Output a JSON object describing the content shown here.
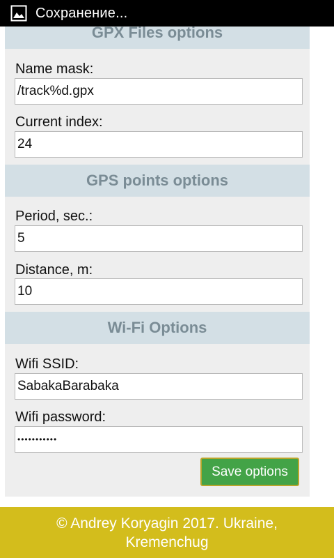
{
  "status_bar": {
    "text": "Сохранение...",
    "icon": "image-icon"
  },
  "gpx_section": {
    "title": "GPX Files options",
    "name_mask_label": "Name mask:",
    "name_mask_value": "/track%d.gpx",
    "current_index_label": "Current index:",
    "current_index_value": "24"
  },
  "gps_section": {
    "title": "GPS points options",
    "period_label": "Period, sec.:",
    "period_value": "5",
    "distance_label": "Distance, m:",
    "distance_value": "10"
  },
  "wifi_section": {
    "title": "Wi-Fi Options",
    "ssid_label": "Wifi SSID:",
    "ssid_value": "SabakaBarabaka",
    "password_label": "Wifi password:",
    "password_value": "•••••••••••"
  },
  "save_button": "Save options",
  "footer": "© Andrey Koryagin 2017. Ukraine, Kremenchug",
  "colors": {
    "section_header_bg": "#d3dfe5",
    "section_header_text": "#7a8c95",
    "panel_bg": "#eeeeee",
    "save_button_bg": "#43a347",
    "footer_bg": "#d3bd1c"
  }
}
